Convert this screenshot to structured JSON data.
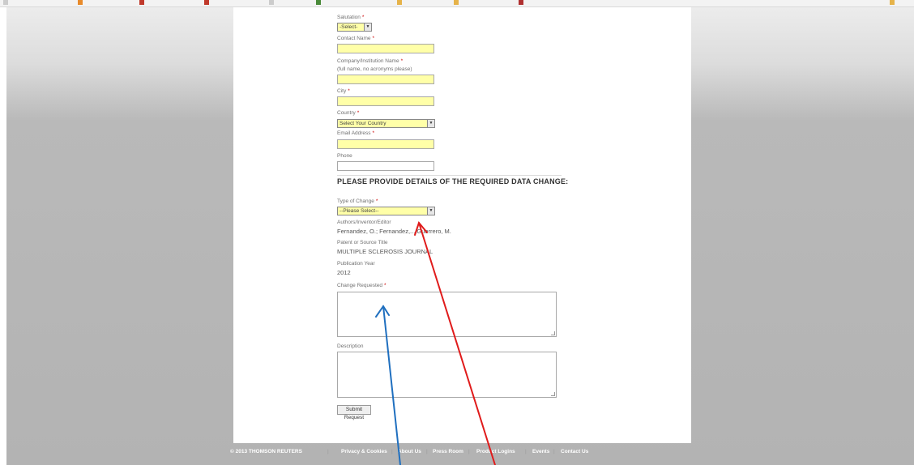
{
  "form": {
    "salutation": {
      "label": "Salutation",
      "required": "*",
      "value": "-Select-"
    },
    "contact_name": {
      "label": "Contact Name",
      "required": "*"
    },
    "company": {
      "label": "Company/Institution Name",
      "required": "*",
      "hint": "(full name, no acronyms please)"
    },
    "city": {
      "label": "City",
      "required": "*"
    },
    "country": {
      "label": "Country",
      "required": "*",
      "value": "Select Your Country"
    },
    "email": {
      "label": "Email Address",
      "required": "*"
    },
    "phone": {
      "label": "Phone"
    },
    "section_heading": "PLEASE PROVIDE DETAILS OF THE REQUIRED DATA CHANGE:",
    "type_of_change": {
      "label": "Type of Change",
      "required": "*",
      "value": "--Please Select--"
    },
    "authors": {
      "label": "Authors/Inventor/Editor",
      "value": "Fernandez, O.; Fernandez,... Guerrero, M."
    },
    "patent_title": {
      "label": "Patent or Source Title",
      "value": "MULTIPLE SCLEROSIS JOURNAL"
    },
    "pub_year": {
      "label": "Publication Year",
      "value": "2012"
    },
    "change_requested": {
      "label": "Change Requested",
      "required": "*"
    },
    "description": {
      "label": "Description"
    },
    "submit_label": "Submit Request"
  },
  "footer": {
    "copyright": "© 2013 THOMSON REUTERS",
    "links": [
      "Privacy & Cookies",
      "About Us",
      "Press Room",
      "Product Logins",
      "Events",
      "Contact Us"
    ],
    "separator": "|"
  },
  "colors": {
    "required_field": "#ffffa8",
    "required_marker": "#cc0000",
    "arrow_blue": "#1f6fbf",
    "arrow_red": "#e01b1b"
  }
}
